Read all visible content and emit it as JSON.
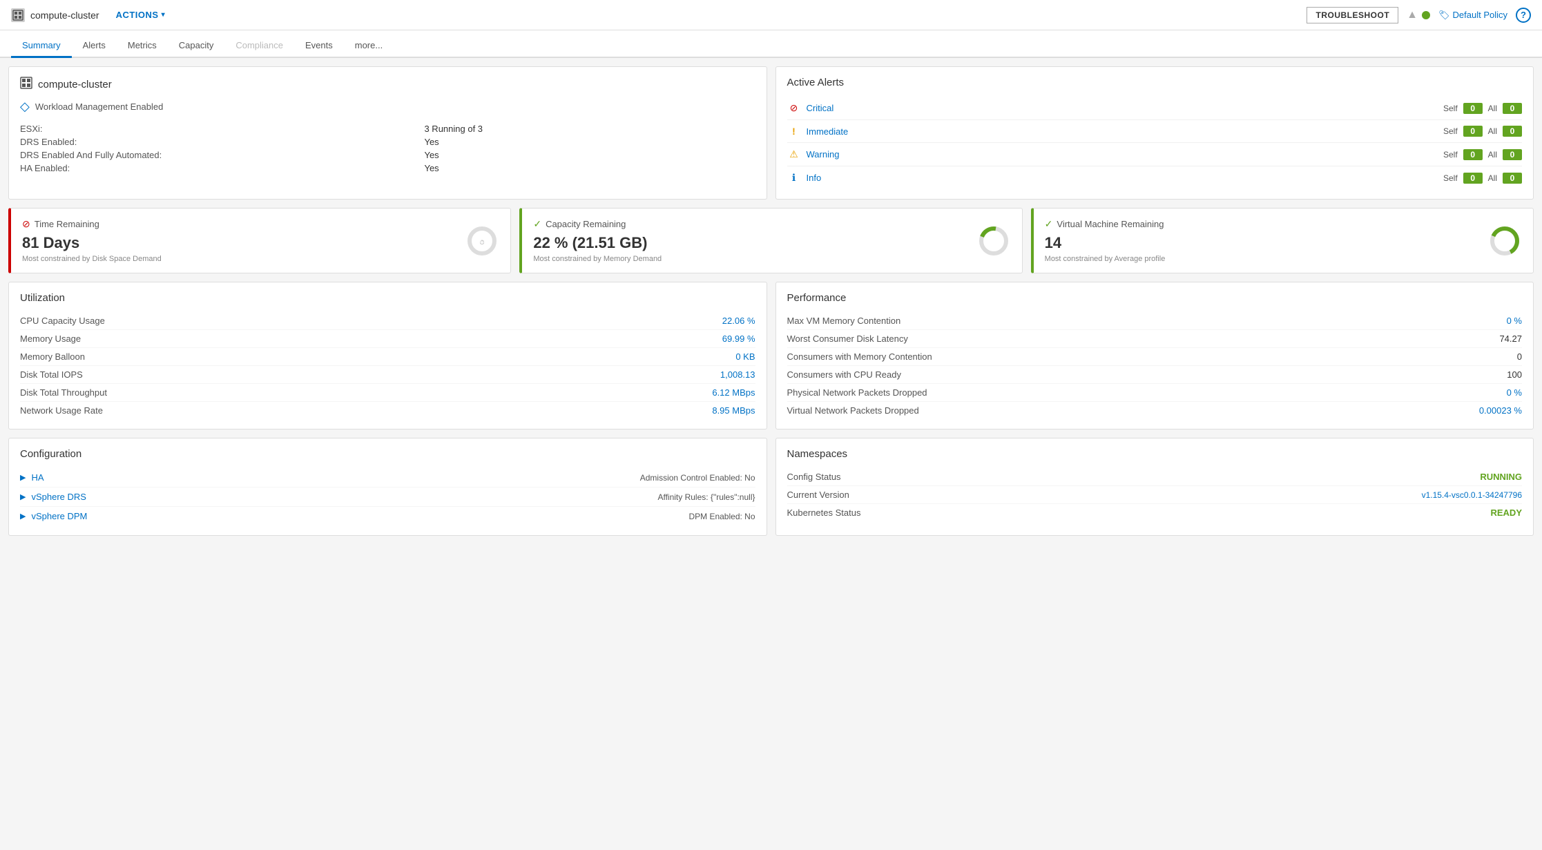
{
  "topbar": {
    "cluster_name": "compute-cluster",
    "actions_label": "ACTIONS",
    "troubleshoot_label": "TROUBLESHOOT",
    "policy_label": "Default Policy",
    "help_label": "?"
  },
  "tabs": [
    {
      "label": "Summary",
      "active": true
    },
    {
      "label": "Alerts",
      "active": false
    },
    {
      "label": "Metrics",
      "active": false
    },
    {
      "label": "Capacity",
      "active": false
    },
    {
      "label": "Compliance",
      "active": false,
      "disabled": true
    },
    {
      "label": "Events",
      "active": false
    },
    {
      "label": "more...",
      "active": false
    }
  ],
  "cluster_info": {
    "title": "compute-cluster",
    "workload_label": "Workload Management Enabled",
    "fields": [
      {
        "label": "ESXi:",
        "value": "3 Running of 3"
      },
      {
        "label": "DRS Enabled:",
        "value": "Yes"
      },
      {
        "label": "DRS Enabled And Fully Automated:",
        "value": "Yes"
      },
      {
        "label": "HA Enabled:",
        "value": "Yes"
      }
    ]
  },
  "active_alerts": {
    "title": "Active Alerts",
    "rows": [
      {
        "type": "critical",
        "label": "Critical",
        "self": "0",
        "all": "0"
      },
      {
        "type": "immediate",
        "label": "Immediate",
        "self": "0",
        "all": "0"
      },
      {
        "type": "warning",
        "label": "Warning",
        "self": "0",
        "all": "0"
      },
      {
        "type": "info",
        "label": "Info",
        "self": "0",
        "all": "0"
      }
    ],
    "self_label": "Self",
    "all_label": "All"
  },
  "metrics": [
    {
      "id": "time-remaining",
      "title": "Time Remaining",
      "value": "81 Days",
      "sub": "Most constrained by Disk Space Demand",
      "status": "red"
    },
    {
      "id": "capacity-remaining",
      "title": "Capacity Remaining",
      "value": "22 % (21.51 GB)",
      "sub": "Most constrained by Memory Demand",
      "status": "green"
    },
    {
      "id": "vm-remaining",
      "title": "Virtual Machine Remaining",
      "value": "14",
      "sub": "Most constrained by Average profile",
      "status": "green"
    }
  ],
  "utilization": {
    "title": "Utilization",
    "rows": [
      {
        "label": "CPU Capacity Usage",
        "value": "22.06 %",
        "is_link": true
      },
      {
        "label": "Memory Usage",
        "value": "69.99 %",
        "is_link": true
      },
      {
        "label": "Memory Balloon",
        "value": "0 KB",
        "is_link": true
      },
      {
        "label": "Disk Total IOPS",
        "value": "1,008.13",
        "is_link": true
      },
      {
        "label": "Disk Total Throughput",
        "value": "6.12 MBps",
        "is_link": true
      },
      {
        "label": "Network Usage Rate",
        "value": "8.95 MBps",
        "is_link": true
      }
    ]
  },
  "performance": {
    "title": "Performance",
    "rows": [
      {
        "label": "Max VM Memory Contention",
        "value": "0 %",
        "is_link": true
      },
      {
        "label": "Worst Consumer Disk Latency",
        "value": "74.27",
        "is_link": false
      },
      {
        "label": "Consumers with Memory Contention",
        "value": "0",
        "is_link": false
      },
      {
        "label": "Consumers with CPU Ready",
        "value": "100",
        "is_link": false
      },
      {
        "label": "Physical Network Packets Dropped",
        "value": "0 %",
        "is_link": true
      },
      {
        "label": "Virtual Network Packets Dropped",
        "value": "0.00023 %",
        "is_link": true
      }
    ]
  },
  "configuration": {
    "title": "Configuration",
    "rows": [
      {
        "name": "HA",
        "detail": "Admission Control Enabled: No"
      },
      {
        "name": "vSphere DRS",
        "detail": "Affinity Rules: {\"rules\":null}"
      },
      {
        "name": "vSphere DPM",
        "detail": "DPM Enabled: No"
      }
    ]
  },
  "namespaces": {
    "title": "Namespaces",
    "rows": [
      {
        "label": "Config Status",
        "value": "RUNNING",
        "type": "running"
      },
      {
        "label": "Current Version",
        "value": "v1.15.4-vsc0.0.1-34247796",
        "type": "blue"
      },
      {
        "label": "Kubernetes Status",
        "value": "READY",
        "type": "ready"
      }
    ]
  }
}
